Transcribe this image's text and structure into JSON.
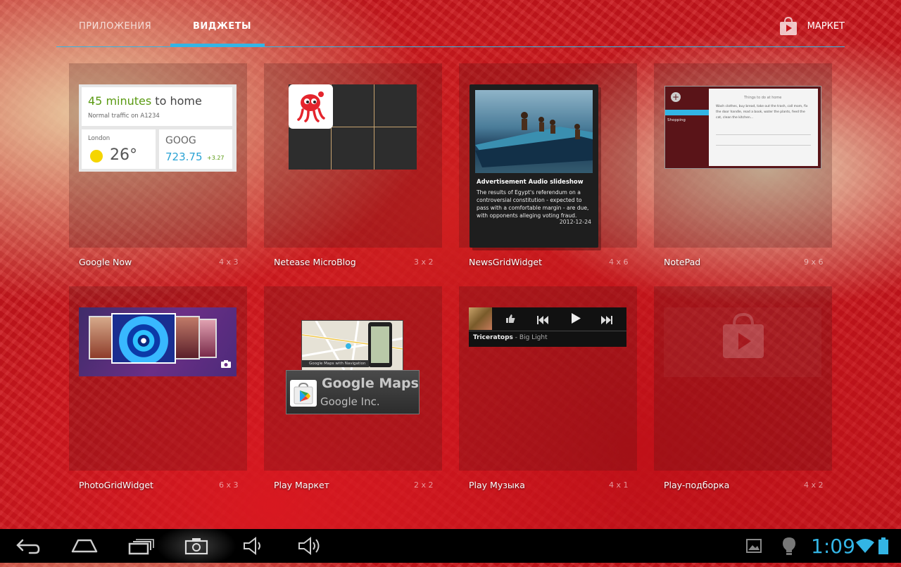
{
  "tabs": {
    "apps_label": "ПРИЛОЖЕНИЯ",
    "widgets_label": "ВИДЖЕТЫ",
    "market_label": "МАРКЕТ"
  },
  "widgets": [
    {
      "name": "Google Now",
      "dims": "4 x 3"
    },
    {
      "name": "Netease MicroBlog",
      "dims": "3 x 2"
    },
    {
      "name": "NewsGridWidget",
      "dims": "4 x 6"
    },
    {
      "name": "NotePad",
      "dims": "9 x 6"
    },
    {
      "name": "PhotoGridWidget",
      "dims": "6 x 3"
    },
    {
      "name": "Play Маркет",
      "dims": "2 x 2"
    },
    {
      "name": "Play Музыка",
      "dims": "4 x 1"
    },
    {
      "name": "Play-подборка",
      "dims": "4 x 2"
    }
  ],
  "google_now": {
    "headline_prefix": "45 minutes",
    "headline_suffix": " to home",
    "traffic": "Normal traffic on A1234",
    "city": "London",
    "temperature": "26°",
    "ticker": "GOOG",
    "price": "723.75",
    "change": "+3.27"
  },
  "news": {
    "title": "Advertisement Audio slideshow",
    "text": "The results of Egypt's referendum on a controversial constitution - expected to pass with a comfortable margin - are due, with opponents alleging voting fraud.",
    "date": "2012-12-24"
  },
  "notepad": {
    "sidebar_item": "Shopping",
    "sheet_title": "Things to do at home",
    "sheet_text": "Wash clothes, buy bread, take out the trash, call mom, fix the door handle, read a book, water the plants, feed the cat, clean the kitchen..."
  },
  "play_market": {
    "app_name": "Google Maps",
    "developer": "Google Inc.",
    "screenshot_caption": "Google Maps with Navigation"
  },
  "music": {
    "track": "Triceratops",
    "separator": " - ",
    "artist": "Big Light"
  },
  "status": {
    "time": "1:09"
  },
  "colors": {
    "accent": "#33b5e5",
    "wallpaper": "#c8151d"
  }
}
